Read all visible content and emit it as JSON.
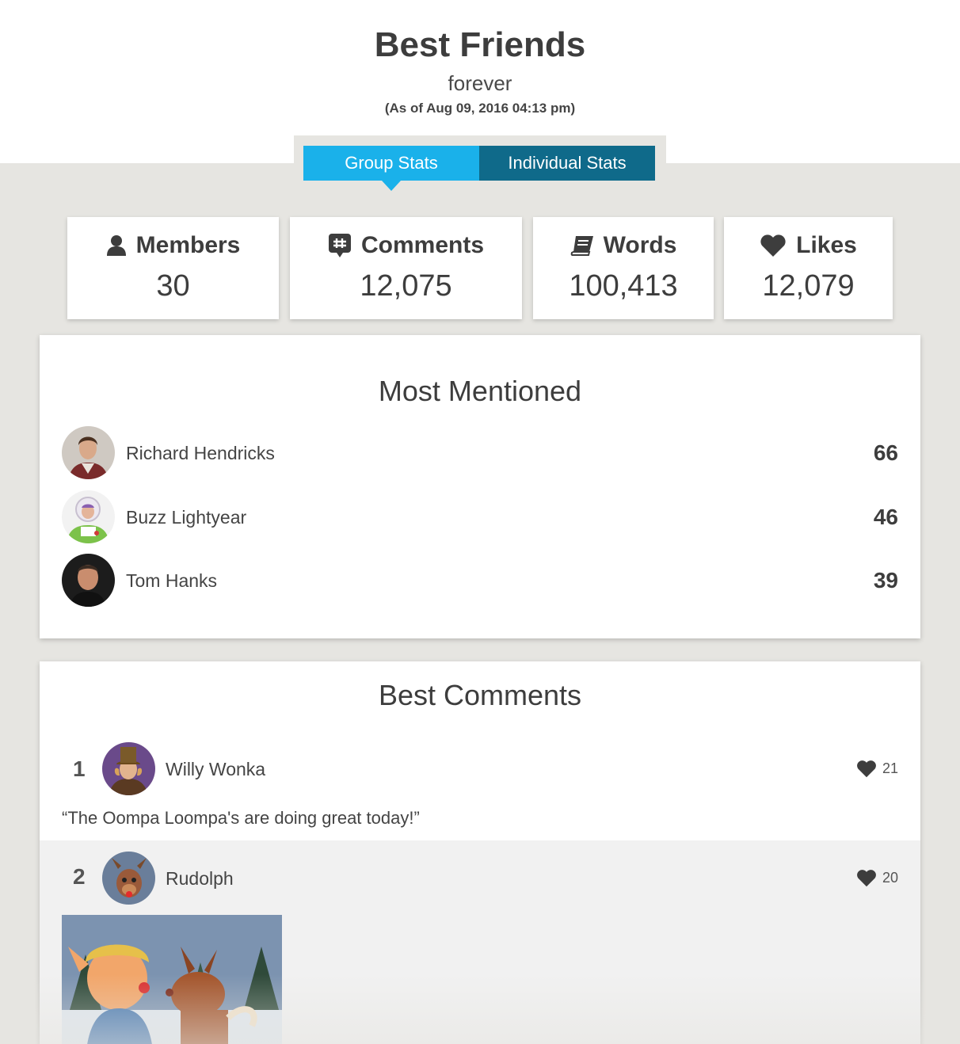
{
  "header": {
    "title": "Best Friends",
    "subtitle": "forever",
    "as_of": "(As of Aug 09, 2016 04:13 pm)"
  },
  "tabs": [
    {
      "label": "Group Stats",
      "active": true
    },
    {
      "label": "Individual Stats",
      "active": false
    }
  ],
  "stats": [
    {
      "label": "Members",
      "value": "30",
      "icon": "user-icon"
    },
    {
      "label": "Comments",
      "value": "12,075",
      "icon": "chat-hash-icon"
    },
    {
      "label": "Words",
      "value": "100,413",
      "icon": "book-icon"
    },
    {
      "label": "Likes",
      "value": "12,079",
      "icon": "heart-icon"
    }
  ],
  "most_mentioned": {
    "title": "Most Mentioned",
    "people": [
      {
        "name": "Richard Hendricks",
        "count": "66"
      },
      {
        "name": "Buzz Lightyear",
        "count": "46"
      },
      {
        "name": "Tom Hanks",
        "count": "39"
      }
    ]
  },
  "best_comments": {
    "title": "Best Comments",
    "items": [
      {
        "rank": "1",
        "name": "Willy Wonka",
        "likes": "21",
        "text": "“The Oompa Loompa's are doing great today!”"
      },
      {
        "rank": "2",
        "name": "Rudolph",
        "likes": "20"
      }
    ]
  },
  "colors": {
    "tab_active": "#1ab1ea",
    "tab_inactive": "#0f6a8a",
    "background": "#e6e5e1"
  }
}
